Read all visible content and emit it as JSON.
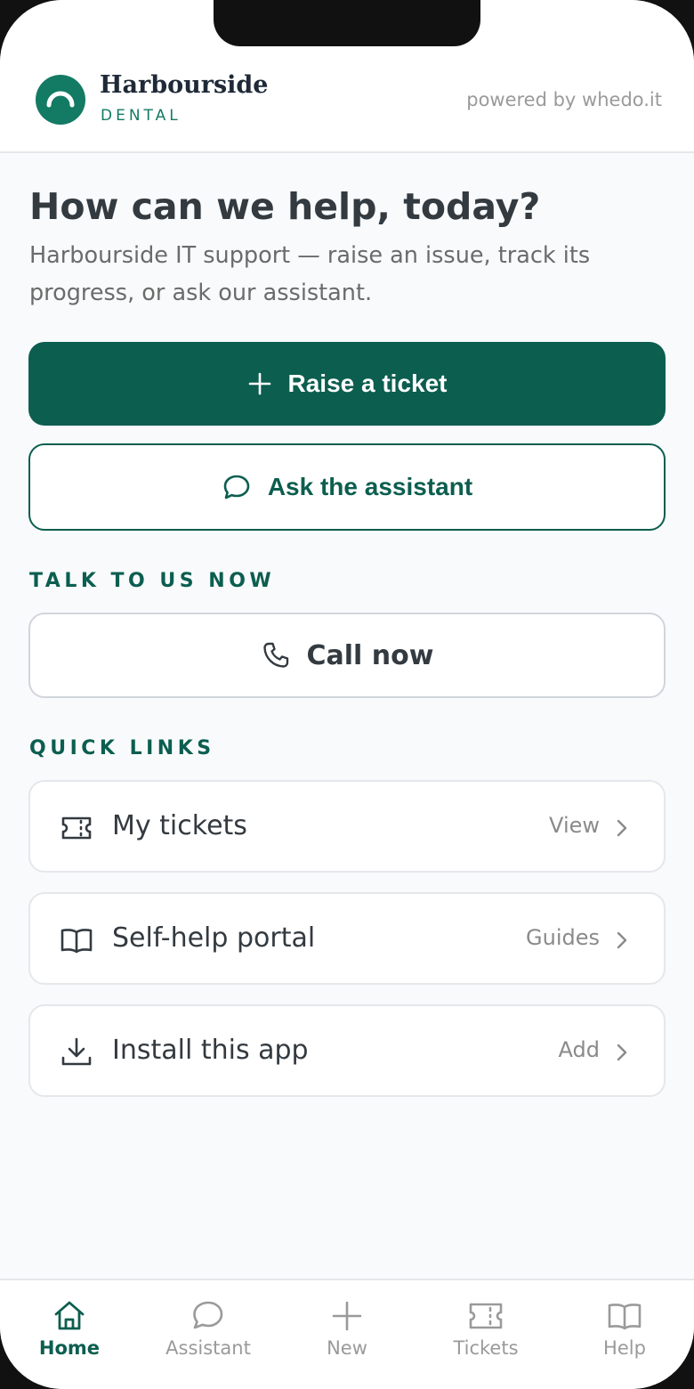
{
  "brand": {
    "name": "Harbourside",
    "subtitle": "DENTAL",
    "powered_by": "powered by whedo.it",
    "accent_color": "#0c5e4f",
    "logo_color": "#137a64"
  },
  "hero": {
    "title": "How can we help, today?",
    "subtitle": "Harbourside IT support — raise an issue, track its progress, or ask our assistant."
  },
  "actions": {
    "raise_ticket": {
      "label": "Raise a ticket",
      "icon": "plus-icon"
    },
    "ask_assistant": {
      "label": "Ask the assistant",
      "icon": "chat-bubble-icon"
    }
  },
  "talk": {
    "heading": "TALK TO US NOW",
    "call_label": "Call now",
    "call_icon": "phone-icon"
  },
  "quick_links": {
    "heading": "QUICK LINKS",
    "items": [
      {
        "label": "My tickets",
        "action": "View",
        "icon": "ticket-icon"
      },
      {
        "label": "Self-help portal",
        "action": "Guides",
        "icon": "book-icon"
      },
      {
        "label": "Install this app",
        "action": "Add",
        "icon": "download-icon"
      }
    ]
  },
  "bottom_nav": {
    "items": [
      {
        "label": "Home",
        "icon": "home-icon",
        "active": true
      },
      {
        "label": "Assistant",
        "icon": "chat-bubble-icon",
        "active": false
      },
      {
        "label": "New",
        "icon": "plus-icon",
        "active": false
      },
      {
        "label": "Tickets",
        "icon": "ticket-icon",
        "active": false
      },
      {
        "label": "Help",
        "icon": "book-icon",
        "active": false
      }
    ]
  }
}
